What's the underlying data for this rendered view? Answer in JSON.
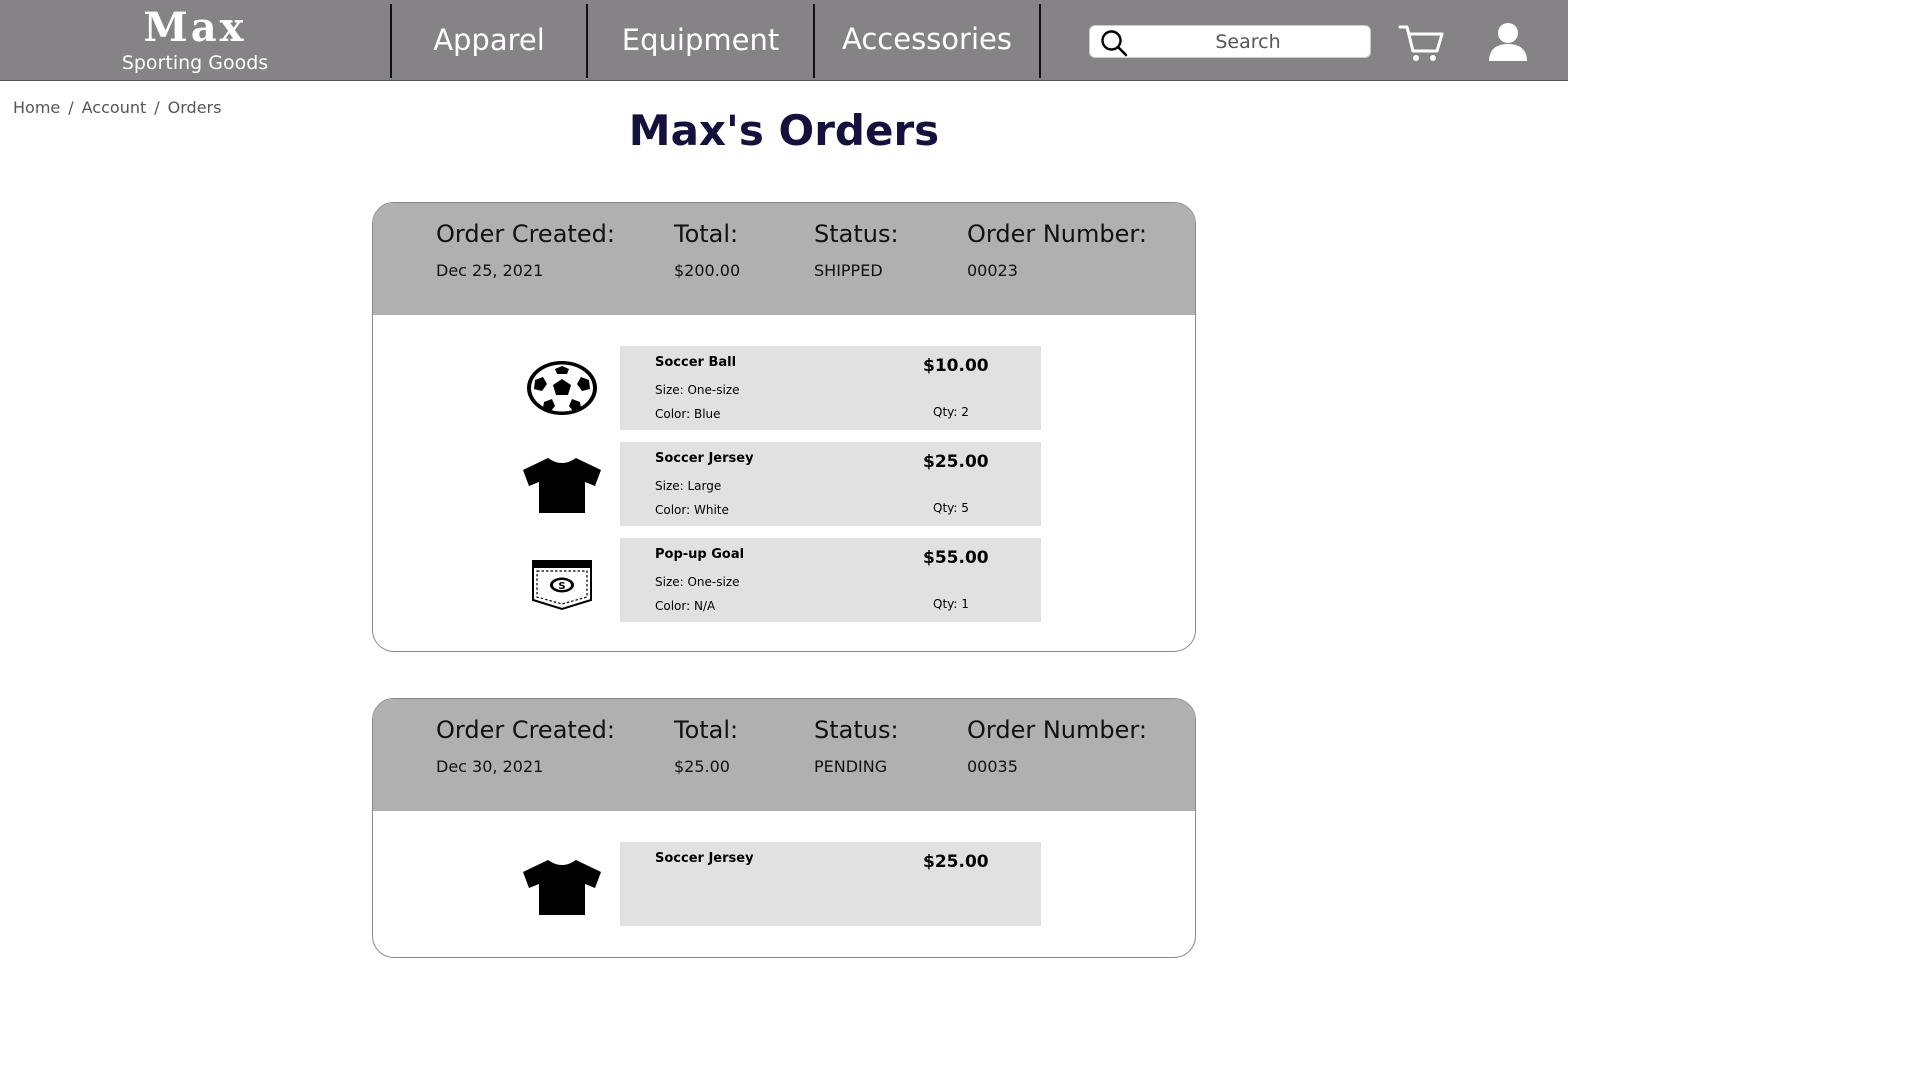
{
  "brand": {
    "name": "Max",
    "tagline": "Sporting Goods"
  },
  "nav": [
    {
      "label": "Apparel"
    },
    {
      "label": "Equipment"
    },
    {
      "label": "Accessories"
    }
  ],
  "search": {
    "placeholder": "Search",
    "icon": "search-icon"
  },
  "header_icons": {
    "cart": "cart-icon",
    "account": "user-icon"
  },
  "breadcrumb": {
    "items": [
      "Home",
      "Account",
      "Orders"
    ],
    "separator": "/"
  },
  "page": {
    "title": "Max's Orders"
  },
  "labels": {
    "created": "Order Created:",
    "total": "Total:",
    "status": "Status:",
    "number": "Order Number:"
  },
  "orders": [
    {
      "created": "Dec 25, 2021",
      "total": "$200.00",
      "status": "SHIPPED",
      "number": "00023",
      "items": [
        {
          "icon": "soccer-ball-icon",
          "name": "Soccer Ball",
          "size": "Size: One-size",
          "color": "Color: Blue",
          "price": "$10.00",
          "qty": "Qty: 2"
        },
        {
          "icon": "t-shirt-icon",
          "name": "Soccer Jersey",
          "size": "Size: Large",
          "color": "Color: White",
          "price": "$25.00",
          "qty": "Qty: 5"
        },
        {
          "icon": "pop-up-goal-icon",
          "name": "Pop-up Goal",
          "size": "Size: One-size",
          "color": "Color: N/A",
          "price": "$55.00",
          "qty": "Qty: 1"
        }
      ]
    },
    {
      "created": "Dec 30, 2021",
      "total": "$25.00",
      "status": "PENDING",
      "number": "00035",
      "items": [
        {
          "icon": "t-shirt-icon",
          "name": "Soccer Jersey",
          "size": "",
          "color": "",
          "price": "$25.00",
          "qty": ""
        }
      ]
    }
  ],
  "colors": {
    "header_bg": "#858385",
    "order_head_bg": "#b0b0b0",
    "item_bg": "#e1e1e1",
    "title": "#14123c"
  }
}
